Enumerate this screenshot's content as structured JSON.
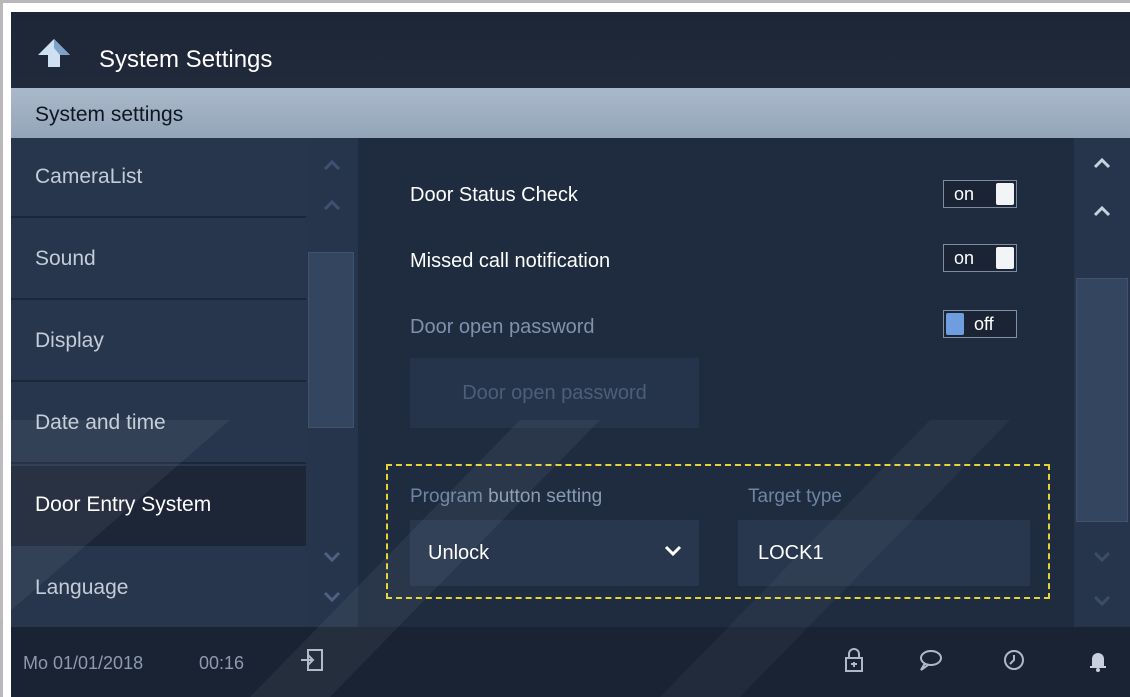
{
  "header": {
    "title": "System Settings"
  },
  "subheader": {
    "label": "System settings"
  },
  "sidebar": {
    "items": [
      {
        "label": "CameraList",
        "active": false
      },
      {
        "label": "Sound",
        "active": false
      },
      {
        "label": "Display",
        "active": false
      },
      {
        "label": "Date and time",
        "active": false
      },
      {
        "label": "Door Entry System",
        "active": true
      },
      {
        "label": "Language",
        "active": false
      }
    ]
  },
  "settings": {
    "door_status_check": {
      "label": "Door Status Check",
      "state": "on"
    },
    "missed_call_notification": {
      "label": "Missed call notification",
      "state": "on"
    },
    "door_open_password": {
      "label": "Door open password",
      "state": "off"
    },
    "door_open_password_button": "Door open password"
  },
  "program_button": {
    "label_part1": "Program ",
    "label_part2": "button setting",
    "selected": "Unlock",
    "target_label": "Target type",
    "target_value": "LOCK1"
  },
  "status": {
    "date": "Mo 01/01/2018",
    "time": "00:16"
  },
  "icons": {
    "back": "back-arrow-icon",
    "logout": "logout-icon",
    "lock": "lock-icon",
    "message": "message-icon",
    "history": "history-icon",
    "bell": "bell-icon"
  },
  "colors": {
    "background": "#1f2c40",
    "subheader": "#a9b8ca",
    "highlight_box": "#e5d437",
    "toggle_off_knob": "#6e9ee0"
  }
}
